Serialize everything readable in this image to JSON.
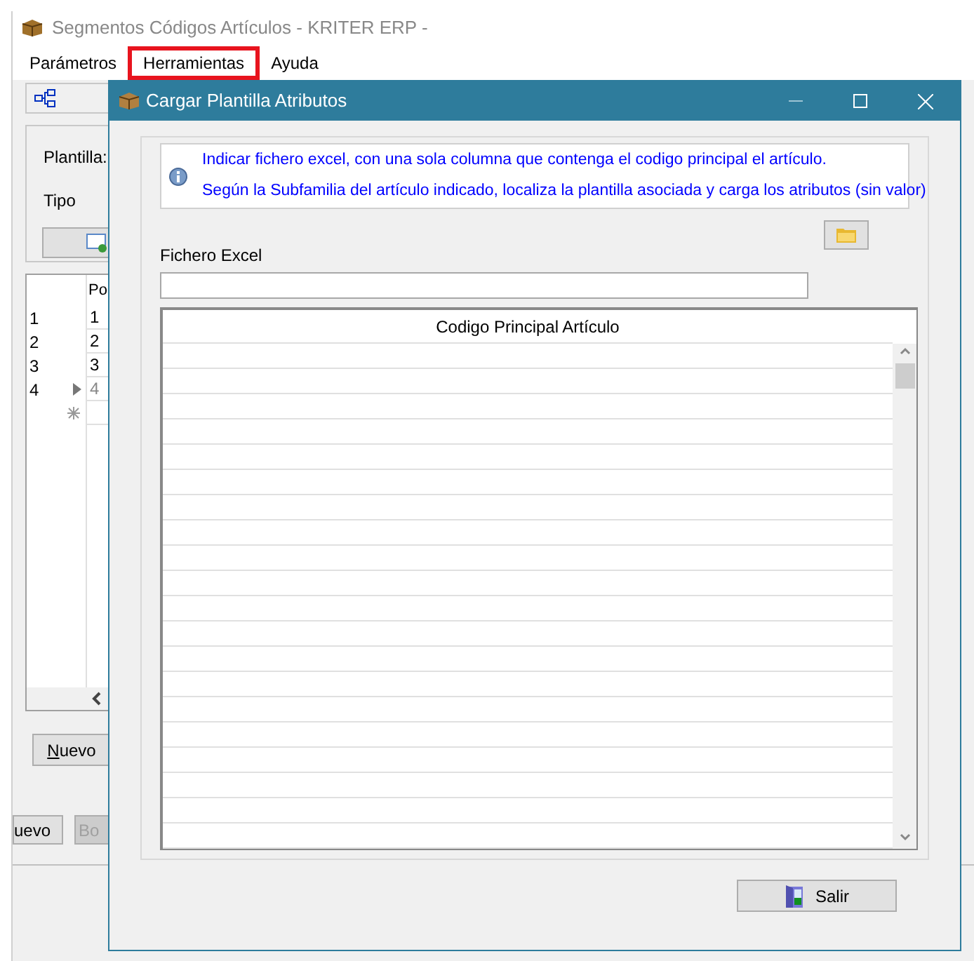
{
  "window": {
    "title": "Segmentos Códigos Artículos - KRITER ERP -"
  },
  "menu": [
    {
      "label": "Parámetros",
      "highlighted": false
    },
    {
      "label": "Herramientas",
      "highlighted": true
    },
    {
      "label": "Ayuda",
      "highlighted": false
    }
  ],
  "form": {
    "labels": [
      "Plantilla:",
      "Tipo"
    ]
  },
  "grid": {
    "column": "Po",
    "rows": [
      {
        "header": "1",
        "value": "1",
        "current": false
      },
      {
        "header": "2",
        "value": "2",
        "current": false
      },
      {
        "header": "3",
        "value": "3",
        "current": false
      },
      {
        "header": "4",
        "value": "4",
        "current": true
      }
    ]
  },
  "buttons": [
    {
      "label": "Nuevo",
      "disabled": false
    },
    {
      "label": "uevo",
      "disabled": false
    },
    {
      "label": "Bo",
      "disabled": true
    }
  ],
  "dialog": {
    "title": "Cargar Plantilla Atributos",
    "info": [
      "Indicar fichero excel, con una sola columna que contenga el codigo principal el artículo.",
      "Según la Subfamilia del artículo indicado, localiza la plantilla asociada y carga los atributos (sin valor)"
    ],
    "field_label": "Fichero Excel",
    "table": {
      "column": "Codigo Principal Artículo"
    },
    "button": "Salir"
  }
}
